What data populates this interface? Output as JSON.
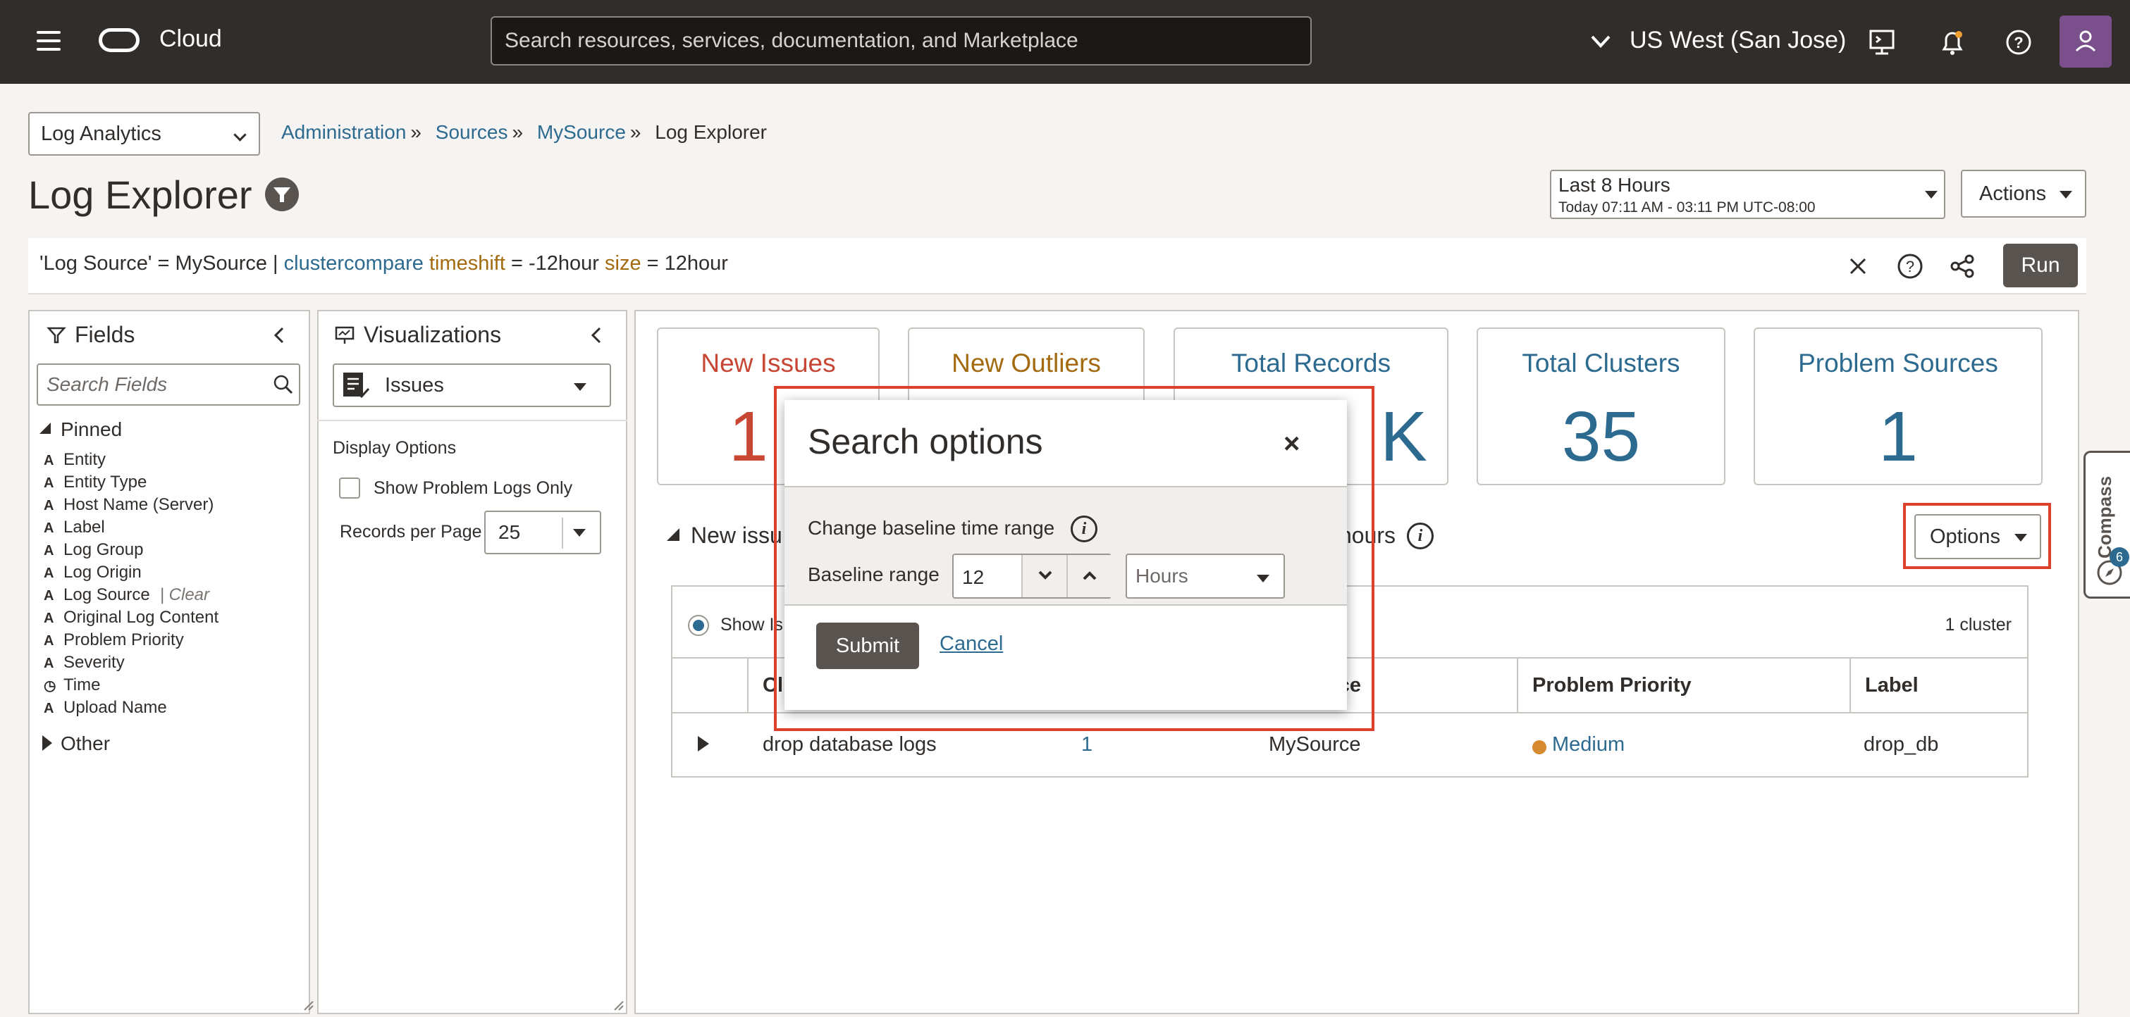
{
  "topbar": {
    "brand": "Cloud",
    "search_placeholder": "Search resources, services, documentation, and Marketplace",
    "region": "US West (San Jose)"
  },
  "subheader": {
    "app_select": "Log Analytics",
    "breadcrumbs": [
      "Administration",
      "Sources",
      "MySource"
    ],
    "breadcrumb_current": "Log Explorer",
    "breadcrumb_sep": "»",
    "page_title": "Log Explorer",
    "time_range": "Last 8 Hours",
    "time_detail": "Today 07:11 AM - 03:11 PM UTC-08:00",
    "actions_label": "Actions"
  },
  "query": {
    "part1": "'Log Source' = MySource | ",
    "kw_cmd": "clustercompare",
    "kw_timeshift": "timeshift",
    "part2": " = -12hour ",
    "kw_size": "size",
    "part3": " = 12hour",
    "run_label": "Run"
  },
  "fields_panel": {
    "title": "Fields",
    "search_placeholder": "Search Fields",
    "pinned_label": "Pinned",
    "items": [
      {
        "type": "A",
        "label": "Entity"
      },
      {
        "type": "A",
        "label": "Entity Type"
      },
      {
        "type": "A",
        "label": "Host Name (Server)"
      },
      {
        "type": "A",
        "label": "Label"
      },
      {
        "type": "A",
        "label": "Log Group"
      },
      {
        "type": "A",
        "label": "Log Origin"
      },
      {
        "type": "A",
        "label": "Log Source"
      },
      {
        "type": "A",
        "label": "Original Log Content"
      },
      {
        "type": "A",
        "label": "Problem Priority"
      },
      {
        "type": "A",
        "label": "Severity"
      },
      {
        "type": "◷",
        "label": "Time"
      },
      {
        "type": "A",
        "label": "Upload Name"
      }
    ],
    "clear_label": "Clear",
    "other_label": "Other"
  },
  "vis_panel": {
    "title": "Visualizations",
    "selected": "Issues",
    "display_options": "Display Options",
    "show_problem_logs": "Show Problem Logs Only",
    "records_per_page_label": "Records per Page",
    "records_per_page": "25"
  },
  "cards": [
    {
      "title": "New Issues",
      "value": "1",
      "color": "#c74634"
    },
    {
      "title": "New Outliers",
      "value": "",
      "color": "#a36a10"
    },
    {
      "title": "Total Records",
      "value": "K",
      "color": "#2d6a8f"
    },
    {
      "title": "Total Clusters",
      "value": "35",
      "color": "#2d6a8f"
    },
    {
      "title": "Problem Sources",
      "value": "1",
      "color": "#2d6a8f"
    }
  ],
  "results": {
    "section_left": "New issu",
    "section_right": "hours",
    "options_label": "Options",
    "show_label": "Show Is",
    "cluster_count": "1 cluster",
    "columns": [
      "Cl",
      "ource",
      "Problem Priority",
      "Label"
    ],
    "row": {
      "cluster": "drop database logs",
      "count": "1",
      "source": "MySource",
      "priority": "Medium",
      "priority_color": "#d58a2f",
      "label": "drop_db"
    }
  },
  "modal": {
    "title": "Search options",
    "close": "×",
    "change_label": "Change baseline time range",
    "baseline_label": "Baseline range",
    "baseline_value": "12",
    "unit": "Hours",
    "submit": "Submit",
    "cancel": "Cancel"
  },
  "compass": {
    "label": "Compass",
    "badge": "6"
  }
}
